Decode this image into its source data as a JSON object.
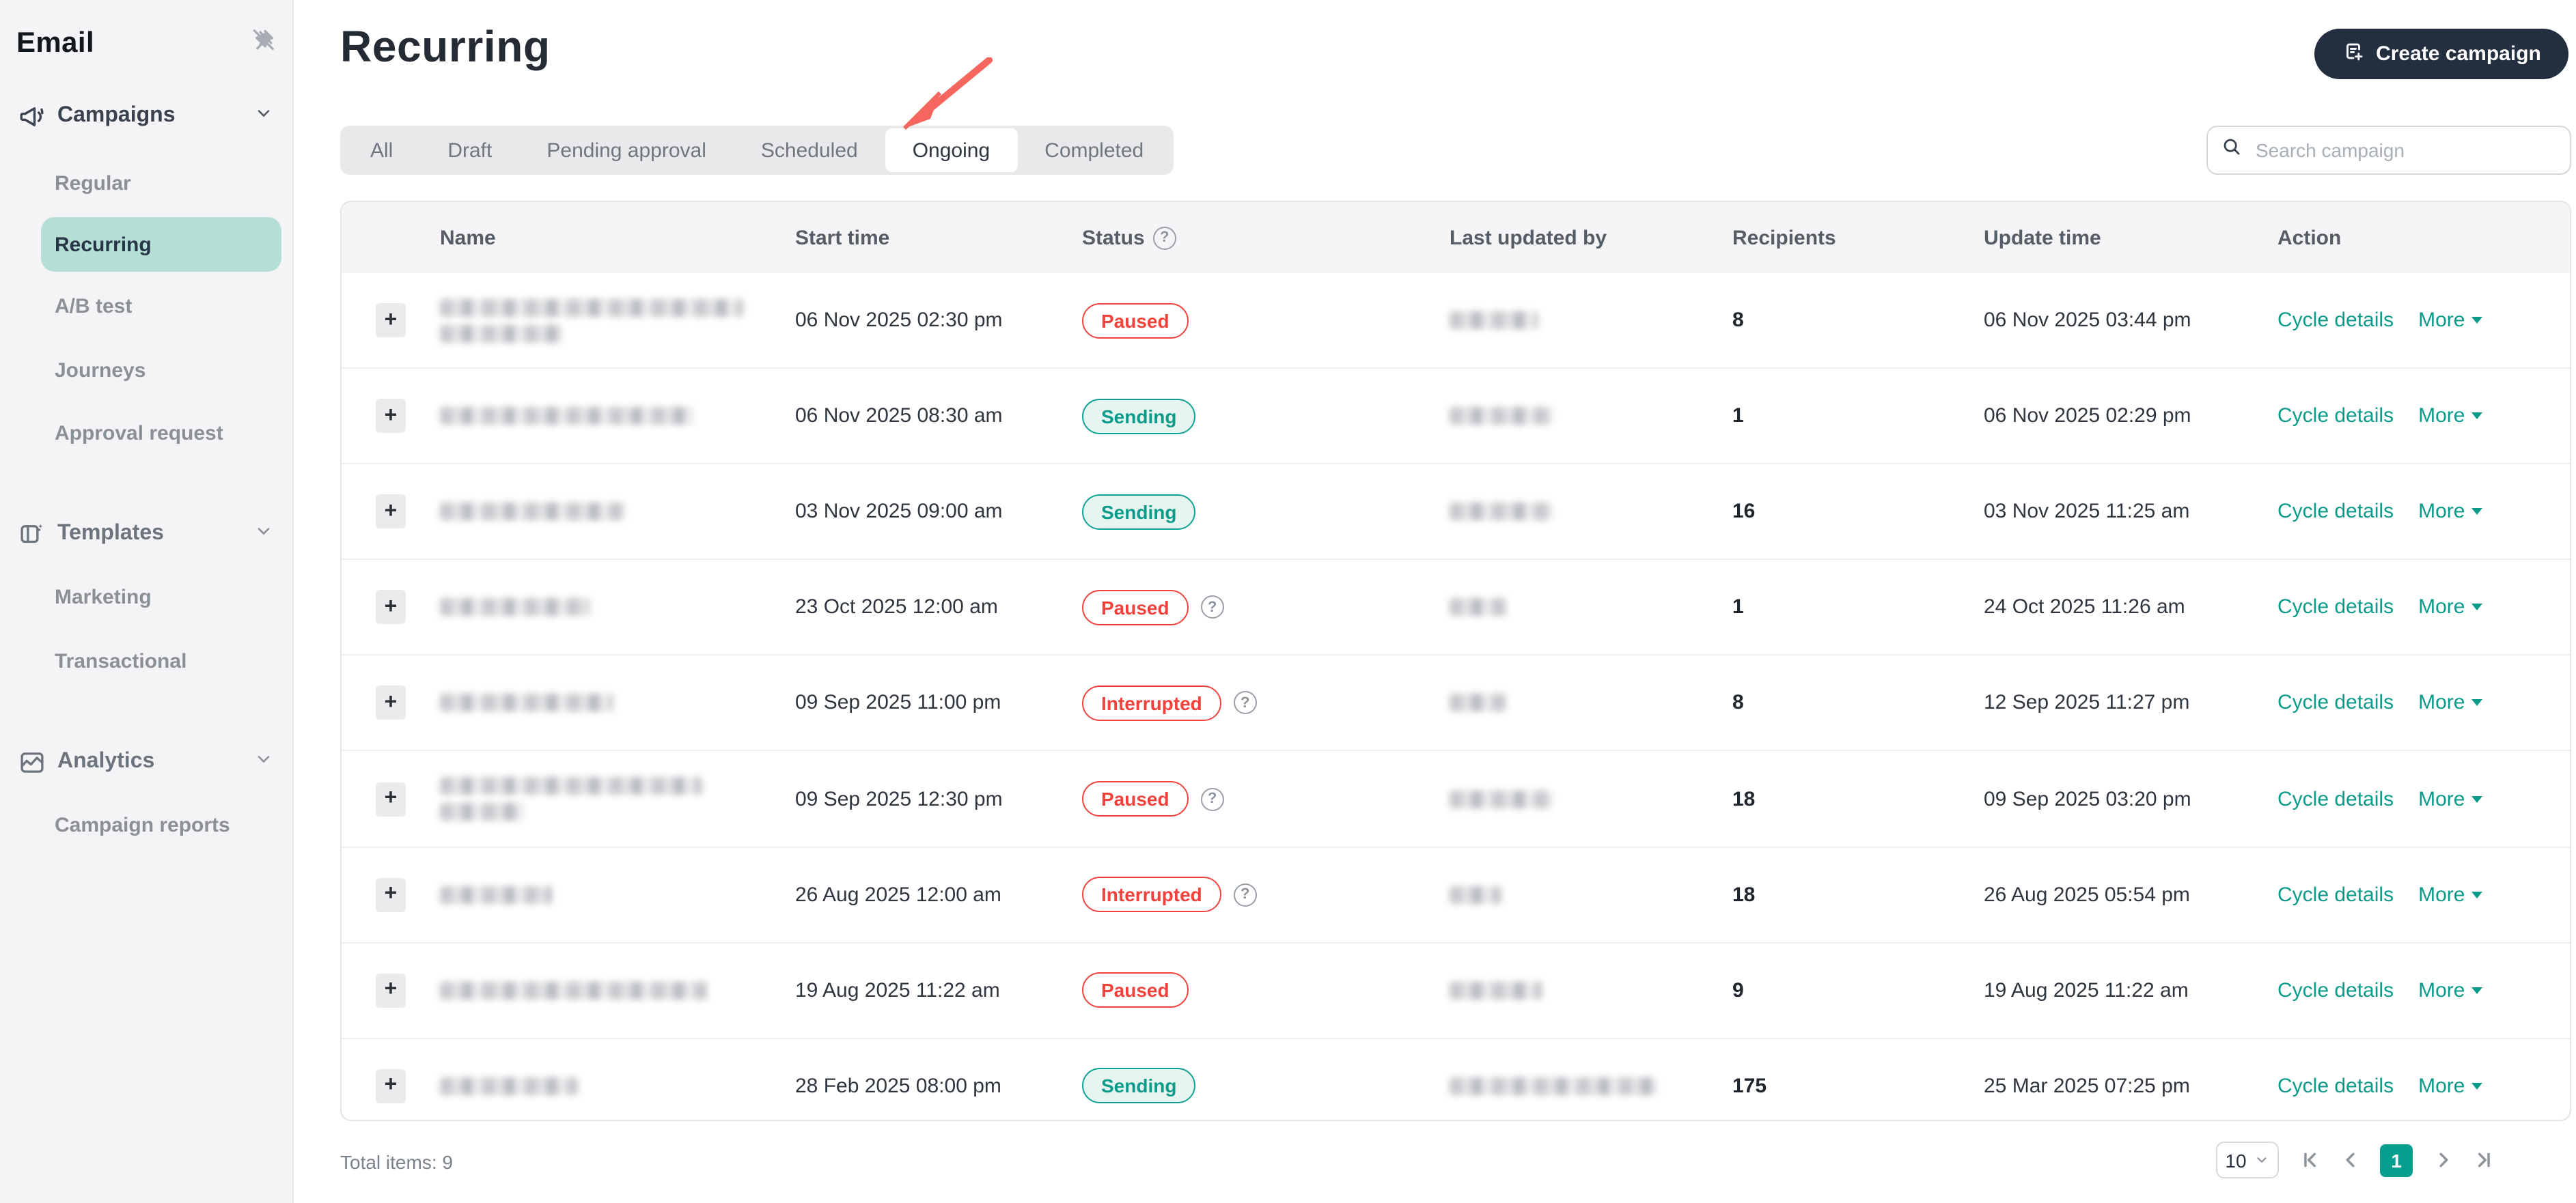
{
  "sidebar": {
    "title": "Email",
    "groups": [
      {
        "label": "Campaigns",
        "icon": "megaphone-icon",
        "items": [
          {
            "label": "Regular"
          },
          {
            "label": "Recurring",
            "active": true
          },
          {
            "label": "A/B test"
          },
          {
            "label": "Journeys"
          },
          {
            "label": "Approval request"
          }
        ]
      },
      {
        "label": "Templates",
        "icon": "templates-icon",
        "items": [
          {
            "label": "Marketing"
          },
          {
            "label": "Transactional"
          }
        ]
      },
      {
        "label": "Analytics",
        "icon": "analytics-icon",
        "items": [
          {
            "label": "Campaign reports"
          }
        ]
      }
    ]
  },
  "header": {
    "title": "Recurring",
    "create_button": "Create campaign",
    "search_placeholder": "Search campaign"
  },
  "tabs": [
    {
      "label": "All"
    },
    {
      "label": "Draft"
    },
    {
      "label": "Pending approval"
    },
    {
      "label": "Scheduled"
    },
    {
      "label": "Ongoing",
      "active": true
    },
    {
      "label": "Completed"
    }
  ],
  "table": {
    "columns": [
      "Name",
      "Start time",
      "Status",
      "Last updated by",
      "Recipients",
      "Update time",
      "Action"
    ],
    "action_labels": {
      "cycle": "Cycle details",
      "more": "More"
    },
    "rows": [
      {
        "start_time": "06 Nov 2025 02:30 pm",
        "status": "Paused",
        "status_type": "paused",
        "has_help": false,
        "recipients": "8",
        "update_time": "06 Nov 2025 03:44 pm"
      },
      {
        "start_time": "06 Nov 2025 08:30 am",
        "status": "Sending",
        "status_type": "sending",
        "has_help": false,
        "recipients": "1",
        "update_time": "06 Nov 2025 02:29 pm"
      },
      {
        "start_time": "03 Nov 2025 09:00 am",
        "status": "Sending",
        "status_type": "sending",
        "has_help": false,
        "recipients": "16",
        "update_time": "03 Nov 2025 11:25 am"
      },
      {
        "start_time": "23 Oct 2025 12:00 am",
        "status": "Paused",
        "status_type": "paused",
        "has_help": true,
        "recipients": "1",
        "update_time": "24 Oct 2025 11:26 am"
      },
      {
        "start_time": "09 Sep 2025 11:00 pm",
        "status": "Interrupted",
        "status_type": "interrupted",
        "has_help": true,
        "recipients": "8",
        "update_time": "12 Sep 2025 11:27 pm"
      },
      {
        "start_time": "09 Sep 2025 12:30 pm",
        "status": "Paused",
        "status_type": "paused",
        "has_help": true,
        "recipients": "18",
        "update_time": "09 Sep 2025 03:20 pm"
      },
      {
        "start_time": "26 Aug 2025 12:00 am",
        "status": "Interrupted",
        "status_type": "interrupted",
        "has_help": true,
        "recipients": "18",
        "update_time": "26 Aug 2025 05:54 pm"
      },
      {
        "start_time": "19 Aug 2025 11:22 am",
        "status": "Paused",
        "status_type": "paused",
        "has_help": false,
        "recipients": "9",
        "update_time": "19 Aug 2025 11:22 am"
      },
      {
        "start_time": "28 Feb 2025 08:00 pm",
        "status": "Sending",
        "status_type": "sending",
        "has_help": false,
        "recipients": "175",
        "update_time": "25 Mar 2025 07:25 pm"
      }
    ]
  },
  "footer": {
    "total_label": "Total items: 9",
    "page_size": "10",
    "current_page": "1"
  },
  "colors": {
    "accent_teal": "#0b9b8a",
    "badge_red": "#f0423d",
    "sidebar_active_bg": "#b5ded4",
    "button_dark": "#232e40",
    "arrow_red": "#f4665e",
    "pagination_active": "#069f8e"
  }
}
